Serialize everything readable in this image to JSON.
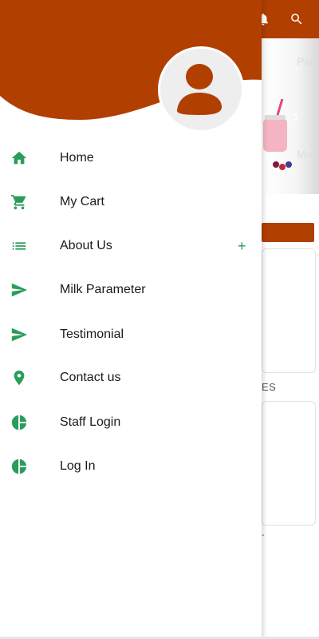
{
  "colors": {
    "header": "#b13f00",
    "icon_green": "#2b9d5b",
    "avatar_bg": "#eeeeee"
  },
  "background_app": {
    "topbar_icons": [
      "bell-icon",
      "search-icon"
    ],
    "section_label": "ES",
    "small_mark": "-"
  },
  "drawer": {
    "avatar_icon": "person-icon",
    "menu": [
      {
        "label": "Home",
        "icon": "home-icon"
      },
      {
        "label": "My Cart",
        "icon": "cart-icon"
      },
      {
        "label": "About Us",
        "icon": "list-icon",
        "expand": "+"
      },
      {
        "label": "Milk Parameter",
        "icon": "send-icon"
      },
      {
        "label": "Testimonial",
        "icon": "send-icon"
      },
      {
        "label": "Contact us",
        "icon": "location-pin-icon"
      },
      {
        "label": "Staff Login",
        "icon": "pie-chart-icon"
      },
      {
        "label": "Log In",
        "icon": "pie-chart-icon"
      }
    ]
  }
}
